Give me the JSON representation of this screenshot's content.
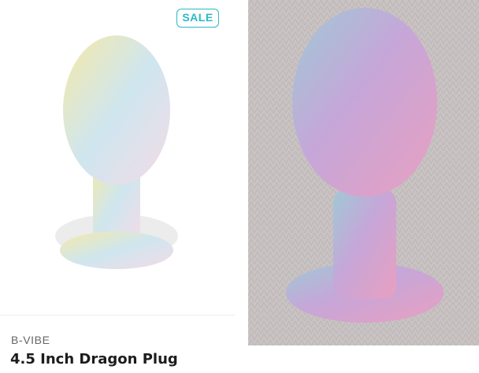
{
  "product_card": {
    "badge": "SALE",
    "brand": "B-VIBE",
    "name": "4.5 Inch Dragon Plug",
    "image_subject": "product-photo"
  },
  "customer_photo": {
    "image_subject": "customer-photo"
  },
  "colors": {
    "badge_accent": "#2bb8c6",
    "brand_text": "#666666",
    "name_text": "#1c1c1c",
    "photo_background": "#c9c3c4"
  }
}
